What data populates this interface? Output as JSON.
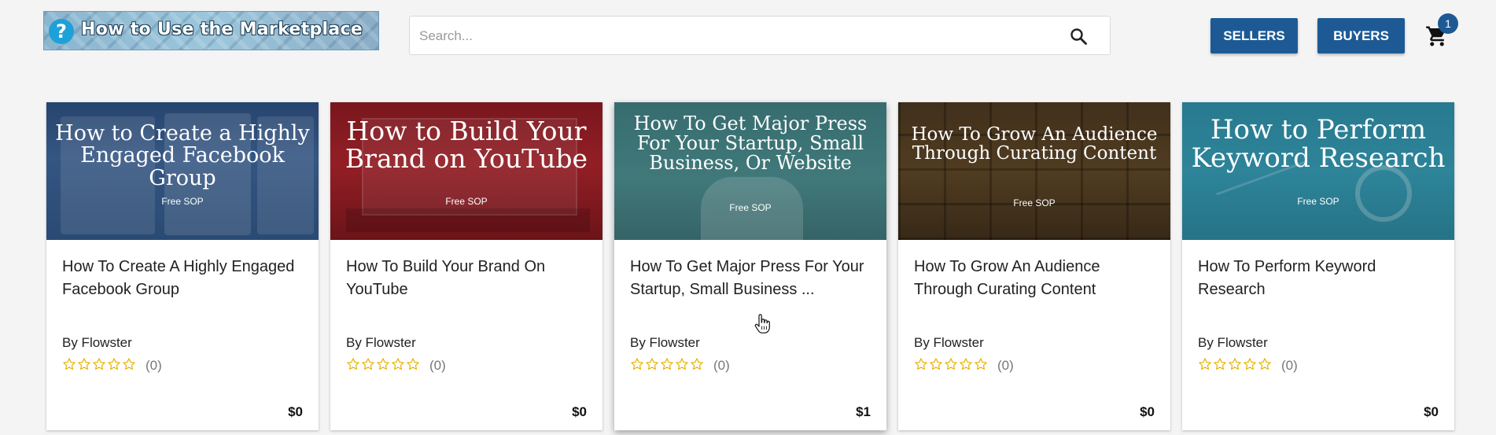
{
  "header": {
    "banner_text": "How to Use the Marketplace",
    "banner_icon": "?",
    "search": {
      "placeholder": "Search...",
      "value": ""
    },
    "sellers_label": "SELLERS",
    "buyers_label": "BUYERS",
    "cart_count": "1"
  },
  "colors": {
    "accent": "#1d5a95",
    "star": "#e8b100",
    "page_bg": "#f4f4f4"
  },
  "products": [
    {
      "image_title": "How to Create a Highly Engaged Facebook Group",
      "image_sub": "Free SOP",
      "title": "How To Create A Highly Engaged Facebook Group",
      "author": "By Flowster",
      "rating": 0,
      "rating_count": "(0)",
      "price": "$0",
      "theme": "facebook"
    },
    {
      "image_title": "How to Build Your Brand on YouTube",
      "image_sub": "Free SOP",
      "title": "How To Build Your Brand On YouTube",
      "author": "By Flowster",
      "rating": 0,
      "rating_count": "(0)",
      "price": "$0",
      "theme": "youtube"
    },
    {
      "image_title": "How To Get Major Press For Your Startup, Small Business, Or Website",
      "image_sub": "Free SOP",
      "title": "How To Get Major Press For Your Startup, Small Business ...",
      "author": "By Flowster",
      "rating": 0,
      "rating_count": "(0)",
      "price": "$1",
      "theme": "press"
    },
    {
      "image_title": "How To Grow An Audience Through Curating Content",
      "image_sub": "Free SOP",
      "title": "How To Grow An Audience Through Curating Content",
      "author": "By Flowster",
      "rating": 0,
      "rating_count": "(0)",
      "price": "$0",
      "theme": "curate"
    },
    {
      "image_title": "How to Perform Keyword Research",
      "image_sub": "Free SOP",
      "title": "How To Perform Keyword Research",
      "author": "By Flowster",
      "rating": 0,
      "rating_count": "(0)",
      "price": "$0",
      "theme": "keyword"
    }
  ]
}
